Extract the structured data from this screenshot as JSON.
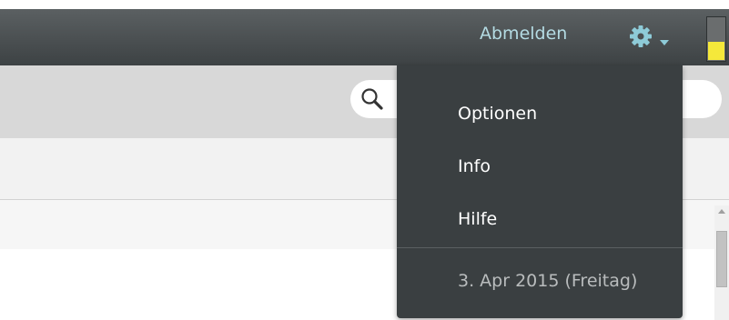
{
  "topbar": {
    "logout_label": "Abmelden"
  },
  "search": {
    "placeholder": ""
  },
  "menu": {
    "items": [
      {
        "label": "Optionen"
      },
      {
        "label": "Info"
      },
      {
        "label": "Hilfe"
      }
    ],
    "date": "3. Apr 2015 (Freitag)"
  },
  "colors": {
    "topbar": "#4a4f51",
    "menu_bg": "#3a3f41",
    "logout_text": "#b4dbe3",
    "gear": "#8ecbd8",
    "battery_fill": "#f5e83a"
  },
  "icons": {
    "settings": "gear-icon",
    "dropdown": "caret-down-icon",
    "search": "search-icon"
  },
  "battery": {
    "level_fraction": 0.45
  }
}
